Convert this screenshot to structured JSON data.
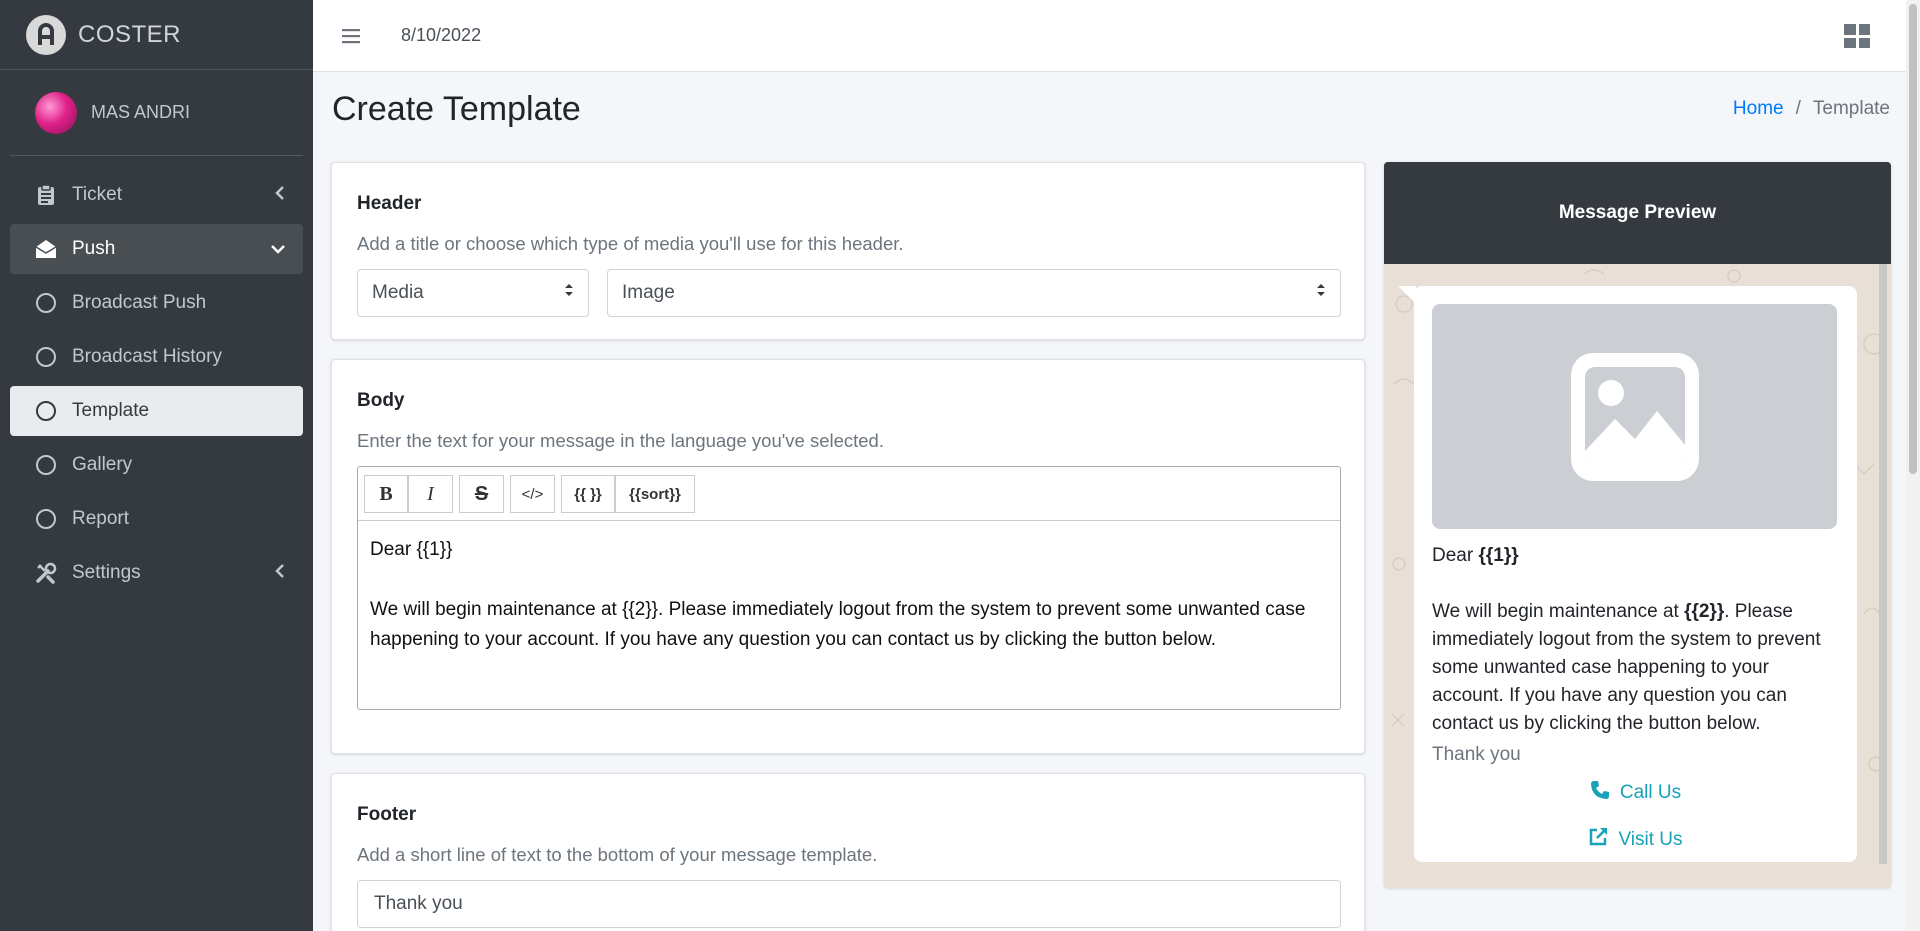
{
  "brand": {
    "name": "COSTER"
  },
  "user": {
    "name": "MAS ANDRI"
  },
  "nav": {
    "ticket": "Ticket",
    "push": "Push",
    "broadcast_push": "Broadcast Push",
    "broadcast_history": "Broadcast History",
    "template": "Template",
    "gallery": "Gallery",
    "report": "Report",
    "settings": "Settings"
  },
  "topbar": {
    "date": "8/10/2022"
  },
  "page": {
    "title": "Create Template"
  },
  "breadcrumb": {
    "home": "Home",
    "separator": "/",
    "current": "Template"
  },
  "header_card": {
    "title": "Header",
    "help": "Add a title or choose which type of media you'll use for this header.",
    "type_value": "Media",
    "media_value": "Image"
  },
  "body_card": {
    "title": "Body",
    "help": "Enter the text for your message in the language you've selected.",
    "toolbar": {
      "bold": "B",
      "italic": "I",
      "strike": "S",
      "code": "</>",
      "var": "{{ }}",
      "sort": "{{sort}}"
    },
    "line1": "Dear {{1}}",
    "line2": "We will begin maintenance at {{2}}. Please immediately logout from the system to prevent some unwanted case happening to your account. If you have any question you can contact us by clicking the button below."
  },
  "footer_card": {
    "title": "Footer",
    "help": "Add a short line of text to the bottom of your message template.",
    "value": "Thank you"
  },
  "preview": {
    "title": "Message Preview",
    "greeting_prefix": "Dear ",
    "greeting_var": "{{1}}",
    "text_prefix": "We will begin maintenance at ",
    "text_var": "{{2}}",
    "text_rest": ". Please immediately logout from the system to prevent some unwanted case happening to your account. If you have any question you can contact us by clicking the button below.",
    "footer": "Thank you",
    "call_label": "Call Us",
    "visit_label": "Visit Us"
  },
  "colors": {
    "sidebar": "#343a40",
    "link": "#007bff",
    "action": "#17a2b8",
    "bubble_bg": "#e8e0d6"
  },
  "icons": [
    "menu-icon",
    "apps-grid-icon",
    "clipboard-icon",
    "envelope-open-icon",
    "circle-icon",
    "tools-icon",
    "image-placeholder-icon",
    "phone-icon",
    "external-link-icon"
  ]
}
